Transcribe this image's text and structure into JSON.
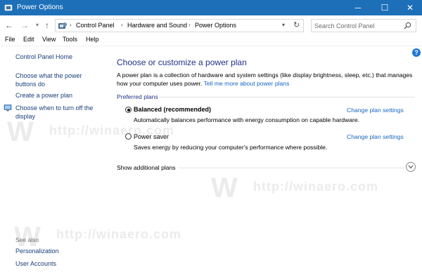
{
  "window": {
    "title": "Power Options",
    "controls": {
      "minimize": "─",
      "maximize": "☐",
      "close": "✕"
    }
  },
  "addressbar": {
    "breadcrumb": [
      "Control Panel",
      "Hardware and Sound",
      "Power Options"
    ],
    "search_placeholder": "Search Control Panel"
  },
  "menu": [
    "File",
    "Edit",
    "View",
    "Tools",
    "Help"
  ],
  "sidebar": {
    "home": "Control Panel Home",
    "links": [
      "Choose what the power buttons do",
      "Create a power plan",
      "Choose when to turn off the display"
    ],
    "see_also_label": "See also",
    "see_also": [
      "Personalization",
      "User Accounts"
    ]
  },
  "main": {
    "title": "Choose or customize a power plan",
    "intro": "A power plan is a collection of hardware and system settings (like display brightness, sleep, etc.) that manages how your computer uses power.",
    "intro_link": "Tell me more about power plans",
    "group_label": "Preferred plans",
    "plans": [
      {
        "name": "Balanced (recommended)",
        "selected": true,
        "description": "Automatically balances performance with energy consumption on capable hardware.",
        "change_link": "Change plan settings"
      },
      {
        "name": "Power saver",
        "selected": false,
        "description": "Saves energy by reducing your computer's performance where possible.",
        "change_link": "Change plan settings"
      }
    ],
    "show_more": "Show additional plans"
  },
  "watermark": {
    "logo": "W",
    "text": "http://winaero.com"
  },
  "colors": {
    "titlebar": "#1d6fb8",
    "link": "#1565c0",
    "heading": "#1e3287",
    "sidebar_link": "#1a3e7a"
  }
}
